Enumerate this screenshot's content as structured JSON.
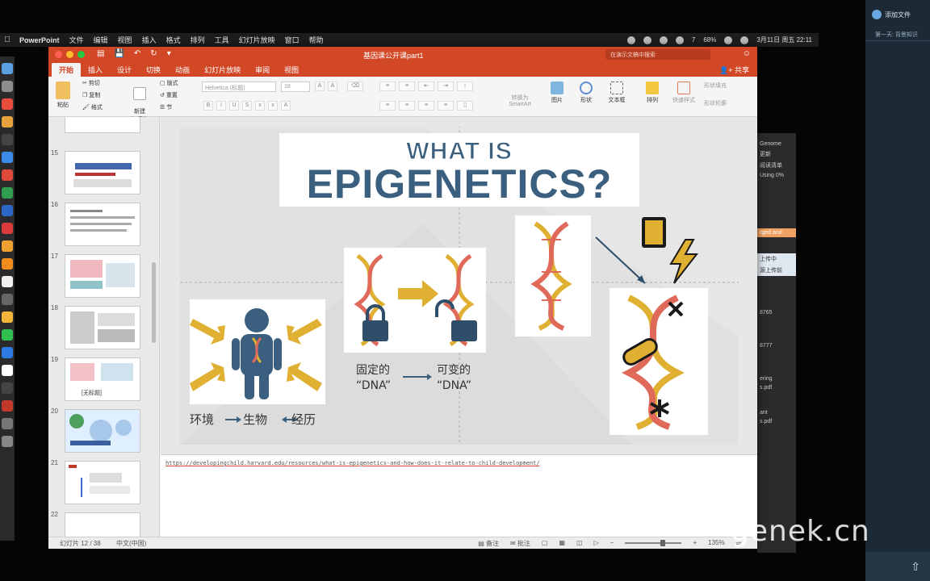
{
  "menubar": {
    "app_name": "PowerPoint",
    "menus": [
      "文件",
      "编辑",
      "视图",
      "插入",
      "格式",
      "排列",
      "工具",
      "幻灯片放映",
      "窗口",
      "帮助"
    ],
    "battery": "68%",
    "wechat_badge": "7",
    "clock": "3月11日 周五 22:11"
  },
  "window": {
    "title": "基因课公开课part1",
    "search_placeholder": "在演示文稿中搜索",
    "share_label": "共享"
  },
  "ribbon": {
    "tabs": [
      "开始",
      "插入",
      "设计",
      "切换",
      "动画",
      "幻灯片放映",
      "审阅",
      "视图"
    ],
    "active_tab": "开始",
    "paste": "粘贴",
    "cut": "剪切",
    "copy": "复制",
    "format": "格式",
    "new_slide": "新建\n幻灯片",
    "layout": "版式",
    "reset": "重置",
    "section": "节",
    "font_name": "Helvetica (标题)",
    "font_size": "18",
    "convert_smartart": "转换为\nSmartArt",
    "picture": "图片",
    "shape": "形状",
    "textbox": "文本框",
    "arrange": "排列",
    "quick_styles": "快速样式",
    "shape_fill": "形状填充",
    "shape_outline": "形状轮廓"
  },
  "thumbnails": [
    {
      "num": "15"
    },
    {
      "num": "16"
    },
    {
      "num": "17"
    },
    {
      "num": "18"
    },
    {
      "num": "19",
      "caption": "[无标题]"
    },
    {
      "num": "20"
    },
    {
      "num": "21"
    },
    {
      "num": "22"
    }
  ],
  "slide": {
    "title_line1": "WHAT IS",
    "title_line2": "EPIGENETICS?",
    "left_caption": {
      "env": "环境",
      "organism": "生物",
      "experience": "经历"
    },
    "middle_caption": {
      "fixed": "固定的",
      "variable": "可变的",
      "fixed_dna": "“DNA”",
      "variable_dna": "“DNA”"
    }
  },
  "notes": {
    "link": "https://developingchild.harvard.edu/resources/what-is-epigenetics-and-how-does-it-relate-to-child-development/"
  },
  "status": {
    "slide_counter": "幻灯片 12 / 38",
    "language": "中文(中国)",
    "notes_label": "备注",
    "comments_label": "批注",
    "zoom": "135%"
  },
  "background_app": {
    "rows": [
      "Genome",
      "更新",
      "阅读清单",
      "Using 0%",
      "rged and",
      "上传中",
      "源上传前",
      "8765",
      "8777",
      "ering",
      "s.pdf",
      "ant",
      "s.pdf"
    ]
  },
  "right_panel": {
    "add_file": "添加文件",
    "item": "第一天: 背景知识"
  },
  "watermark": "genek.cn",
  "colors": {
    "accent": "#d24726",
    "title_blue": "#3b5f7e",
    "dna_gold": "#e0b032",
    "dna_red": "#e06a5a"
  }
}
